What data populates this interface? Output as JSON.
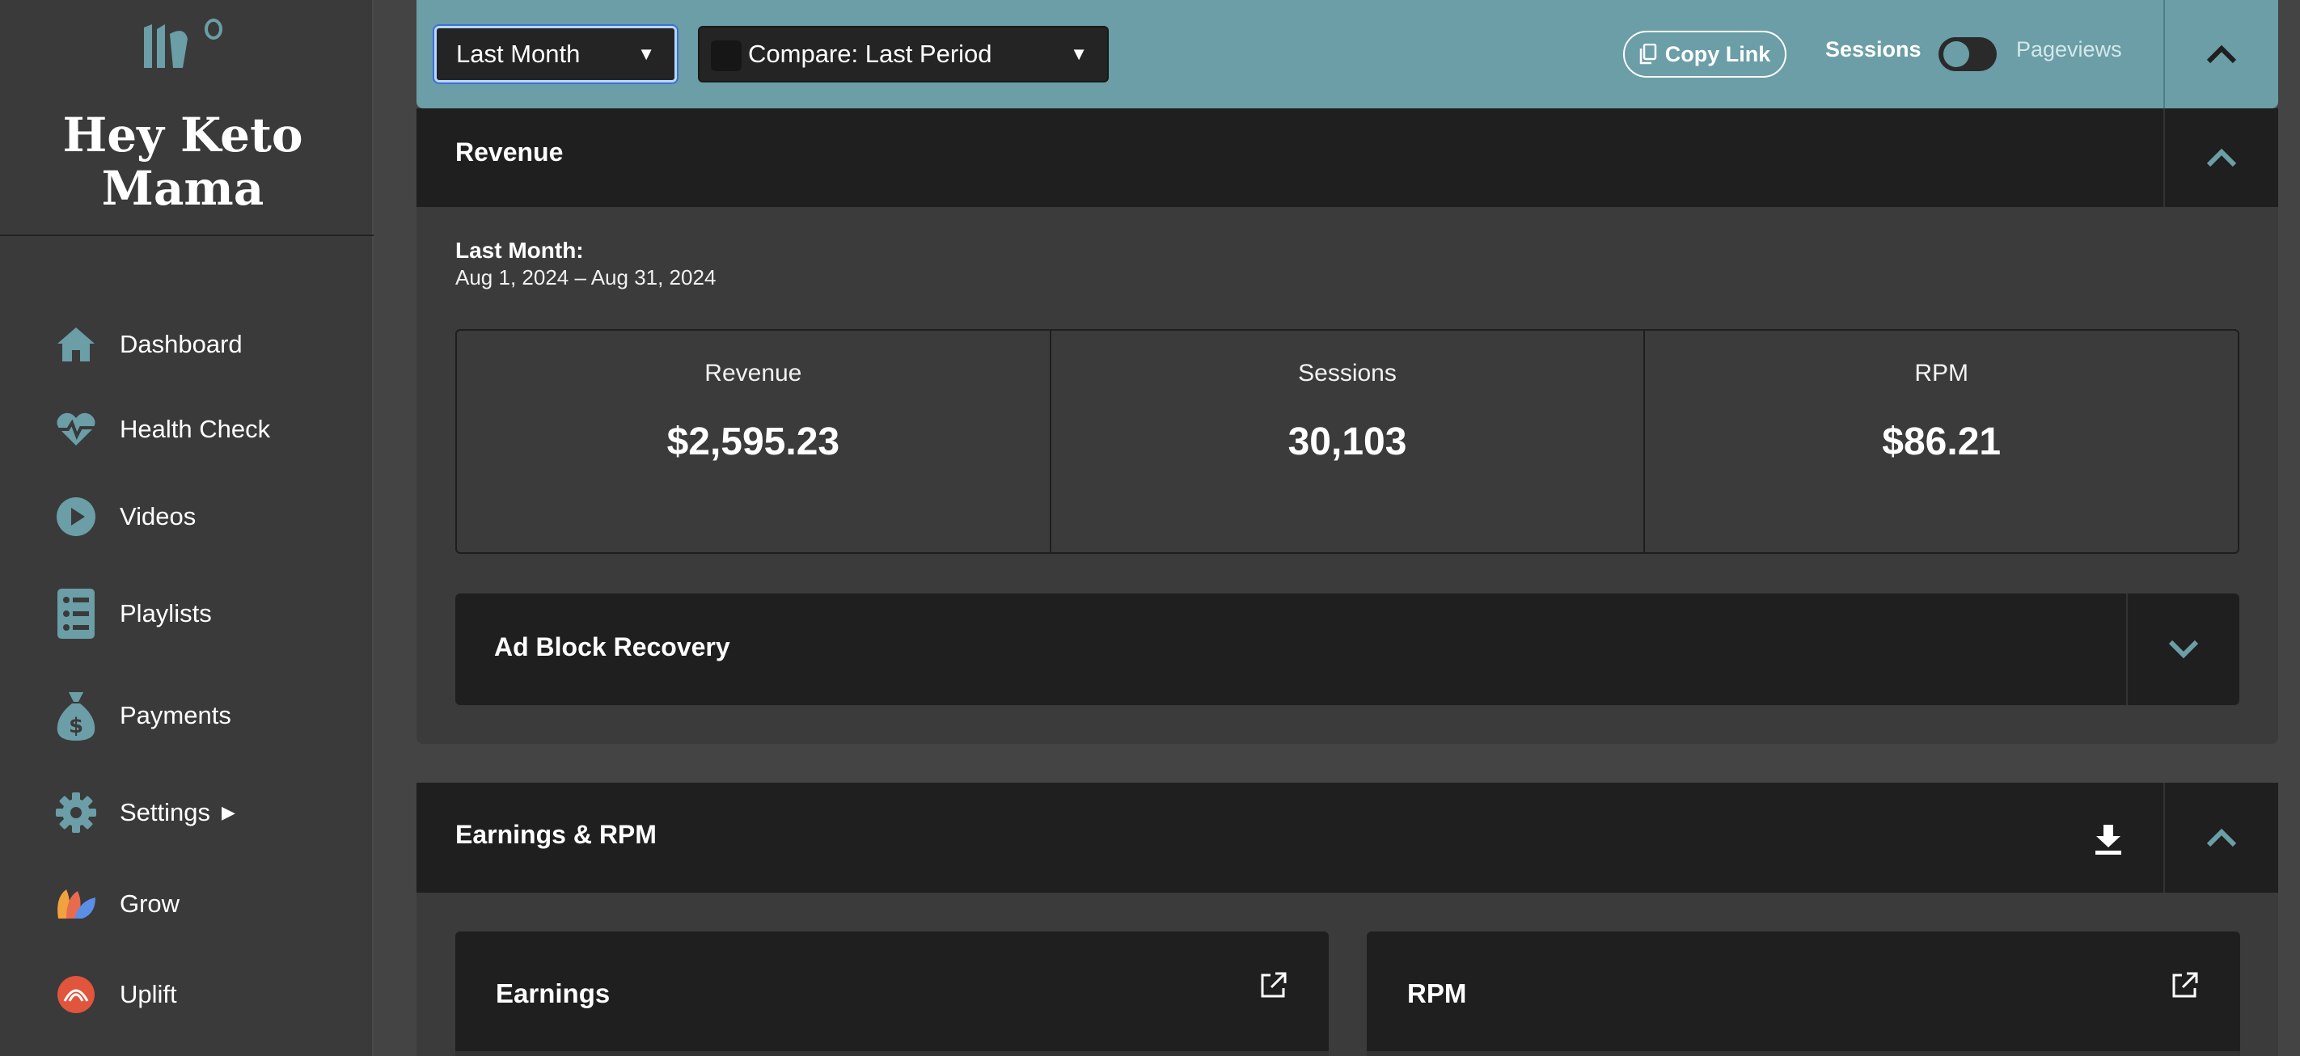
{
  "brand": {
    "line1": "Hey Keto",
    "line2": "Mama"
  },
  "sidebar": {
    "items": [
      {
        "label": "Dashboard",
        "icon": "home-icon"
      },
      {
        "label": "Health Check",
        "icon": "heartbeat-icon"
      },
      {
        "label": "Videos",
        "icon": "play-icon"
      },
      {
        "label": "Playlists",
        "icon": "list-icon"
      },
      {
        "label": "Payments",
        "icon": "money-bag-icon"
      },
      {
        "label": "Settings",
        "icon": "gear-icon"
      },
      {
        "label": "Grow",
        "icon": "grow-leaf-icon"
      },
      {
        "label": "Uplift",
        "icon": "uplift-icon"
      }
    ]
  },
  "toolbar": {
    "date_range": "Last Month",
    "compare": "Compare: Last Period",
    "copy_link": "Copy Link",
    "toggle_left": "Sessions",
    "toggle_right": "Pageviews"
  },
  "revenue": {
    "title": "Revenue",
    "period_label": "Last Month:",
    "period_range": "Aug 1, 2024 – Aug 31, 2024",
    "stats": [
      {
        "label": "Revenue",
        "value": "$2,595.23"
      },
      {
        "label": "Sessions",
        "value": "30,103"
      },
      {
        "label": "RPM",
        "value": "$86.21"
      }
    ],
    "adblock_title": "Ad Block Recovery"
  },
  "earnings": {
    "title": "Earnings & RPM",
    "cards": [
      {
        "title": "Earnings"
      },
      {
        "title": "RPM"
      }
    ]
  },
  "colors": {
    "accent": "#6b9ea7",
    "panel": "#1f1f1f",
    "body": "#3b3b3b",
    "sidebar": "#3a3a3a"
  }
}
